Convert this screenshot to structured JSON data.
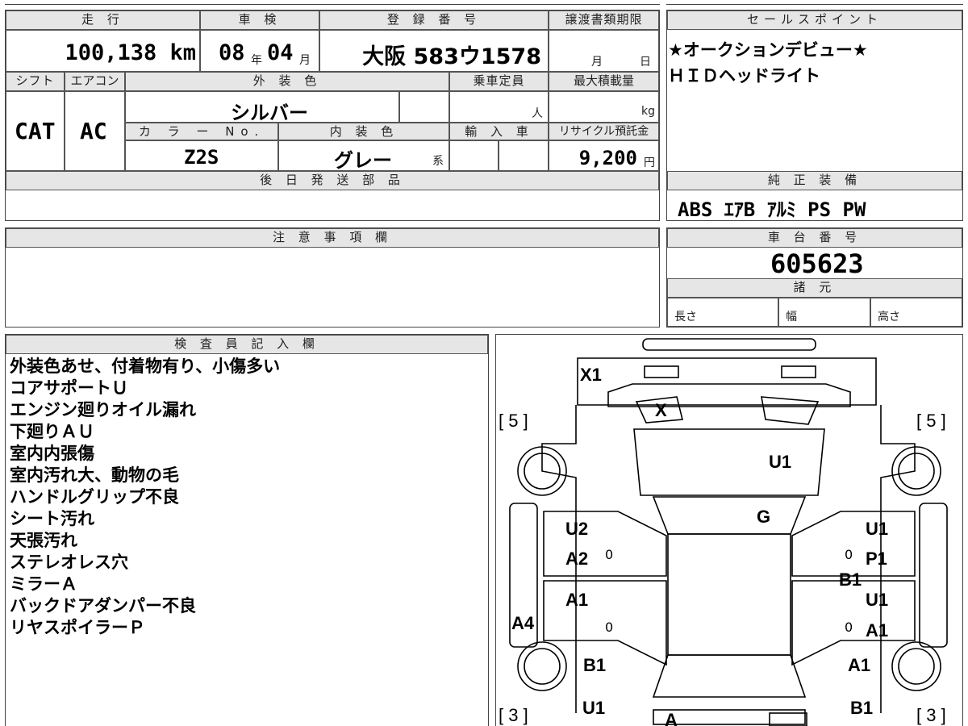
{
  "top_grid": {
    "mileage": {
      "label": "走 行",
      "value": "100,138 km"
    },
    "inspection": {
      "label": "車 検",
      "year": "08",
      "year_unit": "年",
      "month": "04",
      "month_unit": "月"
    },
    "registration": {
      "label": "登 録 番 号",
      "value": "大阪 583ウ1578"
    },
    "transfer_deadline": {
      "label": "譲渡書類期限",
      "month_unit": "月",
      "day_unit": "日"
    },
    "shift": {
      "label": "シフト",
      "value": "CAT"
    },
    "aircon": {
      "label": "エアコン",
      "value": "AC"
    },
    "exterior_color": {
      "label": "外 装 色",
      "value": "シルバー"
    },
    "capacity": {
      "label": "乗車定員",
      "unit": "人"
    },
    "max_load": {
      "label": "最大積載量",
      "unit": "kg"
    },
    "color_no": {
      "label": "カ ラ ー No.",
      "value": "Z2S"
    },
    "interior_color": {
      "label": "内 装 色",
      "value": "グレー",
      "suffix": "系"
    },
    "import": {
      "label": "輸 入 車"
    },
    "recycle": {
      "label": "リサイクル預託金",
      "value": "9,200",
      "unit": "円"
    },
    "later_parts": {
      "label": "後 日 発 送 部 品"
    }
  },
  "sales_point": {
    "label": "セールスポイント",
    "lines": [
      "★オークションデビュー★",
      "ＨＩＤヘッドライト"
    ]
  },
  "equipment": {
    "label": "純 正 装 備",
    "value": "ABS ｴｱB ｱﾙﾐ PS PW"
  },
  "notice": {
    "label": "注 意 事 項 欄"
  },
  "chassis": {
    "label": "車 台 番 号",
    "value": "605623"
  },
  "specs": {
    "label": "諸 元",
    "length": "長さ",
    "width": "幅",
    "height": "高さ"
  },
  "inspector": {
    "label": "検 査 員 記 入 欄",
    "notes": [
      "外装色あせ、付着物有り、小傷多い",
      "コアサポートＵ",
      "エンジン廻りオイル漏れ",
      "下廻りＡＵ",
      "室内内張傷",
      "室内汚れ大、動物の毛",
      "ハンドルグリップ不良",
      "シート汚れ",
      "天張汚れ",
      "ステレオレス穴",
      "ミラーＡ",
      "バックドアダンパー不良",
      "リヤスポイラーＰ"
    ]
  },
  "diagram": {
    "marks": [
      "X1",
      "X",
      "U1",
      "G",
      "U2",
      "A2",
      "U1",
      "P1",
      "B1",
      "A1",
      "U1",
      "A4",
      "A1",
      "B1",
      "A1",
      "U1",
      "B1",
      "A"
    ],
    "zeros": [
      "0",
      "0",
      "0",
      "0"
    ],
    "tire_front_left": "5",
    "tire_front_right": "5",
    "tire_rear_left": "3",
    "tire_rear_right": "3"
  }
}
